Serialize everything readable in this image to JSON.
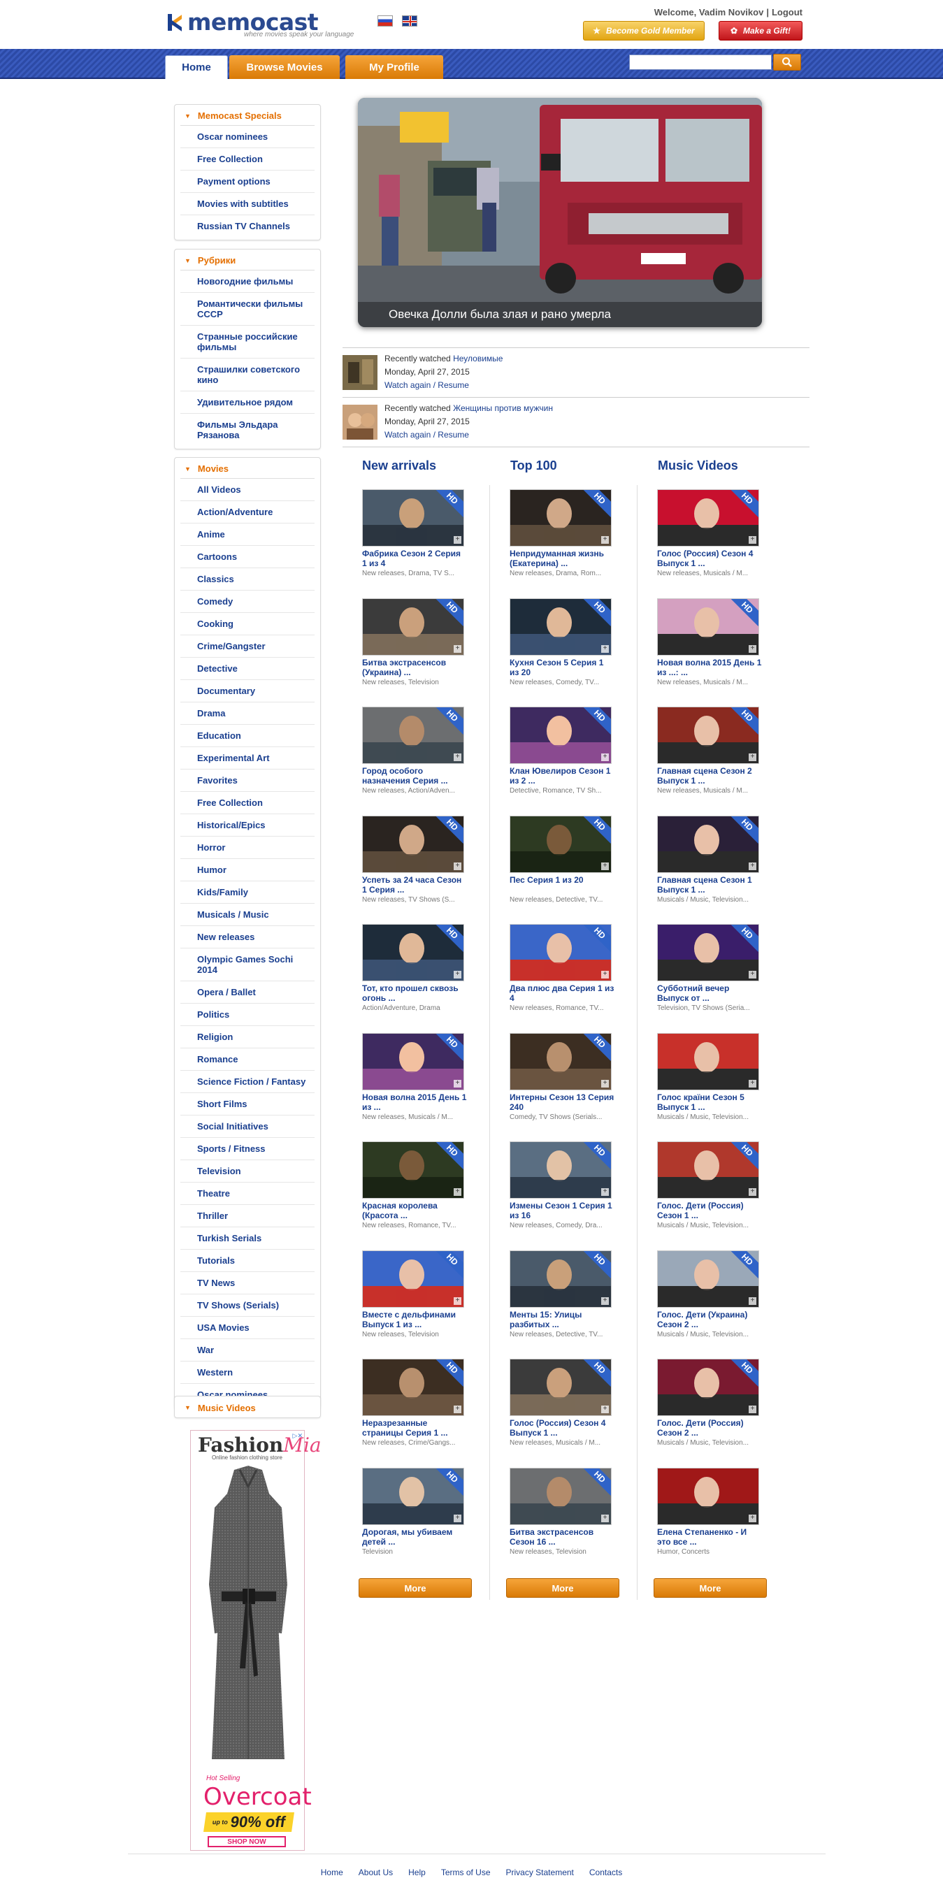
{
  "header": {
    "logo_text": "memocast",
    "tagline": "where movies speak your language",
    "welcome_prefix": "Welcome, Vadim Novikov",
    "logout": "Logout",
    "gold_button": "Become Gold Member",
    "gift_button": "Make a Gift!"
  },
  "nav": {
    "tabs": [
      "Home",
      "Browse Movies",
      "My Profile"
    ],
    "search_placeholder": ""
  },
  "sidebar": {
    "specials": {
      "title": "Memocast Specials",
      "items": [
        "Oscar nominees",
        "Free Collection",
        "Payment options",
        "Movies with subtitles",
        "Russian TV Channels"
      ]
    },
    "rubrics": {
      "title": "Рубрики",
      "items": [
        "Новогодние фильмы",
        "Романтически фильмы СССР",
        "Странные российские фильмы",
        "Страшилки советского кино",
        "Удивительное рядом",
        "Фильмы Эльдара Рязанова"
      ]
    },
    "movies": {
      "title": "Movies",
      "items": [
        "All Videos",
        "Action/Adventure",
        "Anime",
        "Cartoons",
        "Classics",
        "Comedy",
        "Cooking",
        "Crime/Gangster",
        "Detective",
        "Documentary",
        "Drama",
        "Education",
        "Experimental Art",
        "Favorites",
        "Free Collection",
        "Historical/Epics",
        "Horror",
        "Humor",
        "Kids/Family",
        "Musicals / Music",
        "New releases",
        "Olympic Games Sochi 2014",
        "Opera / Ballet",
        "Politics",
        "Religion",
        "Romance",
        "Science Fiction / Fantasy",
        "Short Films",
        "Social Initiatives",
        "Sports / Fitness",
        "Television",
        "Theatre",
        "Thriller",
        "Turkish Serials",
        "Tutorials",
        "TV News",
        "TV Shows (Serials)",
        "USA Movies",
        "War",
        "Western",
        "Oscar nominees"
      ]
    },
    "music": {
      "title": "Music Videos"
    }
  },
  "ad": {
    "brand": "Fashion",
    "brand_script": "Mia",
    "subtitle": "Online fashion clothing store",
    "hot": "Hot Selling",
    "product": "Overcoat",
    "up_to": "up to",
    "discount": "90% off",
    "cta": "SHOP NOW"
  },
  "hero": {
    "caption": "Овечка Долли была злая и рано умерла"
  },
  "recent": [
    {
      "prefix": "Recently watched",
      "title": "Неуловимые",
      "date": "Monday, April 27, 2015",
      "watch_again": "Watch again",
      "resume": "Resume"
    },
    {
      "prefix": "Recently watched",
      "title": "Женщины против мужчин",
      "date": "Monday, April 27, 2015",
      "watch_again": "Watch again",
      "resume": "Resume"
    }
  ],
  "columns": [
    {
      "title": "New arrivals",
      "more": "More",
      "items": [
        {
          "title": "Фабрика Сезон 2 Серия 1 из 4",
          "genres": "New releases, Drama, TV S...",
          "hd": true
        },
        {
          "title": "Битва экстрасенсов (Украина) ...",
          "genres": "New releases, Television",
          "hd": true
        },
        {
          "title": "Город особого назначения Серия ...",
          "genres": "New releases, Action/Adven...",
          "hd": true
        },
        {
          "title": "Успеть за 24 часа Сезон 1 Серия ...",
          "genres": "New releases, TV Shows (S...",
          "hd": true
        },
        {
          "title": "Тот, кто прошел сквозь огонь ...",
          "genres": "Action/Adventure, Drama",
          "hd": true
        },
        {
          "title": "Новая волна 2015 День 1 из ...",
          "genres": "New releases, Musicals / M...",
          "hd": true
        },
        {
          "title": "Красная королева (Красота ...",
          "genres": "New releases, Romance, TV...",
          "hd": true
        },
        {
          "title": "Вместе с дельфинами Выпуск 1 из ...",
          "genres": "New releases, Television",
          "hd": true
        },
        {
          "title": "Неразрезанные страницы Серия 1 ...",
          "genres": "New releases, Crime/Gangs...",
          "hd": true
        },
        {
          "title": "Дорогая, мы убиваем детей ...",
          "genres": "Television",
          "hd": true
        }
      ]
    },
    {
      "title": "Top 100",
      "more": "More",
      "items": [
        {
          "title": "Непридуманная жизнь (Екатерина) ...",
          "genres": "New releases, Drama, Rom...",
          "hd": true
        },
        {
          "title": "Кухня Сезон 5 Серия 1 из 20",
          "genres": "New releases, Comedy, TV...",
          "hd": true
        },
        {
          "title": "Клан Ювелиров Сезон 1 из 2 ...",
          "genres": "Detective, Romance, TV Sh...",
          "hd": true
        },
        {
          "title": "Пес Серия 1 из 20",
          "genres": "New releases, Detective, TV...",
          "hd": true
        },
        {
          "title": "Два плюс два Серия 1 из 4",
          "genres": "New releases, Romance, TV...",
          "hd": true
        },
        {
          "title": "Интерны Сезон 13 Серия 240",
          "genres": "Comedy, TV Shows (Serials...",
          "hd": true
        },
        {
          "title": "Измены Сезон 1 Серия 1 из 16",
          "genres": "New releases, Comedy, Dra...",
          "hd": true
        },
        {
          "title": "Менты 15: Улицы разбитых ...",
          "genres": "New releases, Detective, TV...",
          "hd": true
        },
        {
          "title": "Голос (Россия) Сезон 4 Выпуск 1 ...",
          "genres": "New releases, Musicals / M...",
          "hd": true
        },
        {
          "title": "Битва экстрасенсов Сезон 16 ...",
          "genres": "New releases, Television",
          "hd": true
        }
      ]
    },
    {
      "title": "Music Videos",
      "more": "More",
      "items": [
        {
          "title": "Голос (Россия) Сезон 4 Выпуск 1 ...",
          "genres": "New releases, Musicals / M...",
          "hd": true
        },
        {
          "title": "Новая волна 2015 День 1 из ...: ...",
          "genres": "New releases, Musicals / M...",
          "hd": true
        },
        {
          "title": "Главная сцена Сезон 2 Выпуск 1 ...",
          "genres": "New releases, Musicals / M...",
          "hd": true
        },
        {
          "title": "Главная сцена Сезон 1 Выпуск 1 ...",
          "genres": "Musicals / Music, Television...",
          "hd": true
        },
        {
          "title": "Суббoтний вечер Выпуск от ...",
          "genres": "Television, TV Shows (Seria...",
          "hd": true
        },
        {
          "title": "Голос країни Сезон 5 Выпуск 1 ...",
          "genres": "Musicals / Music, Television...",
          "hd": false
        },
        {
          "title": "Голос. Дети (Россия) Сезон 1 ...",
          "genres": "Musicals / Music, Television...",
          "hd": true
        },
        {
          "title": "Голос. Дети (Украина) Сезон 2 ...",
          "genres": "Musicals / Music, Television...",
          "hd": true
        },
        {
          "title": "Голос. Дети (Россия) Сезон 2 ...",
          "genres": "Musicals / Music, Television...",
          "hd": true
        },
        {
          "title": "Елена Степаненко - И это все ...",
          "genres": "Humor, Concerts",
          "hd": false
        }
      ]
    }
  ],
  "footer": [
    "Home",
    "About Us",
    "Help",
    "Terms of Use",
    "Privacy Statement",
    "Contacts"
  ],
  "colors": {
    "brand_blue": "#1a3f8f",
    "accent_orange": "#e46f00",
    "hd_blue": "#2f63c8"
  }
}
